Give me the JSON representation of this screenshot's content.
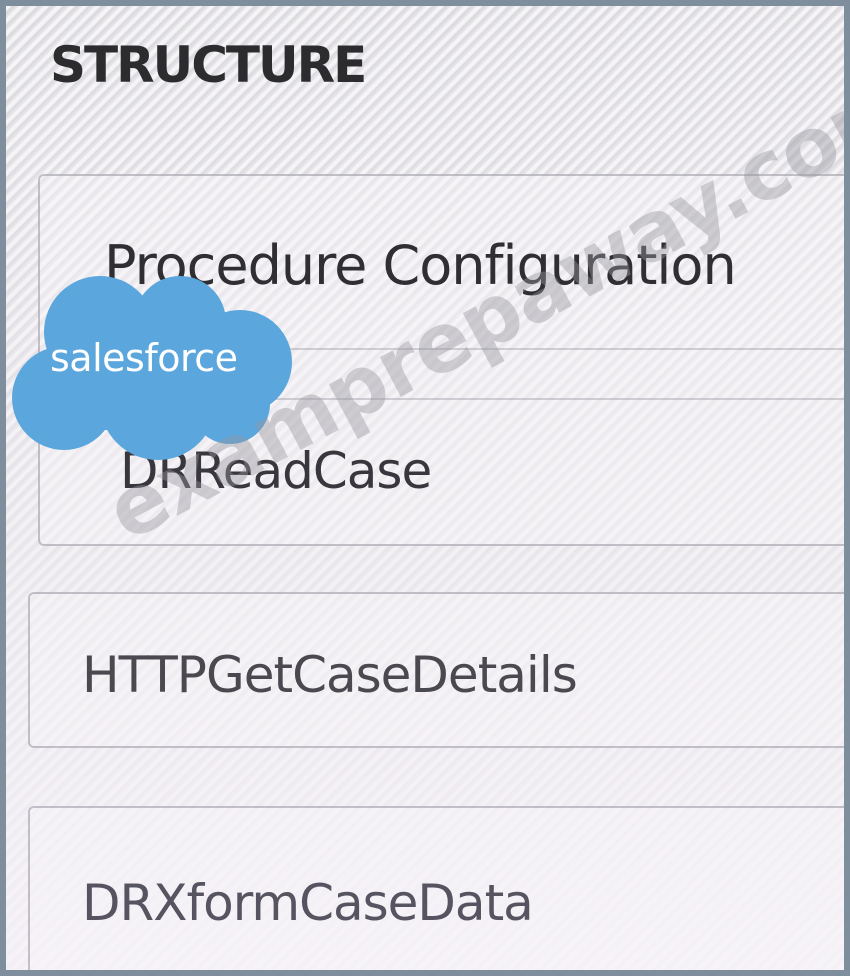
{
  "panel": {
    "title": "STRUCTURE"
  },
  "structure": {
    "items": [
      {
        "label": "Procedure Configuration"
      },
      {
        "label": "DRReadCase"
      },
      {
        "label": "HTTPGetCaseDetails"
      },
      {
        "label": "DRXformCaseData"
      }
    ]
  },
  "overlay": {
    "logo_text": "salesforce",
    "watermark_text": "examprepaway.com",
    "logo_color": "#5aa6dd"
  },
  "colors": {
    "frame_border": "#7f8e9c",
    "text_dark": "#2f2f33"
  }
}
